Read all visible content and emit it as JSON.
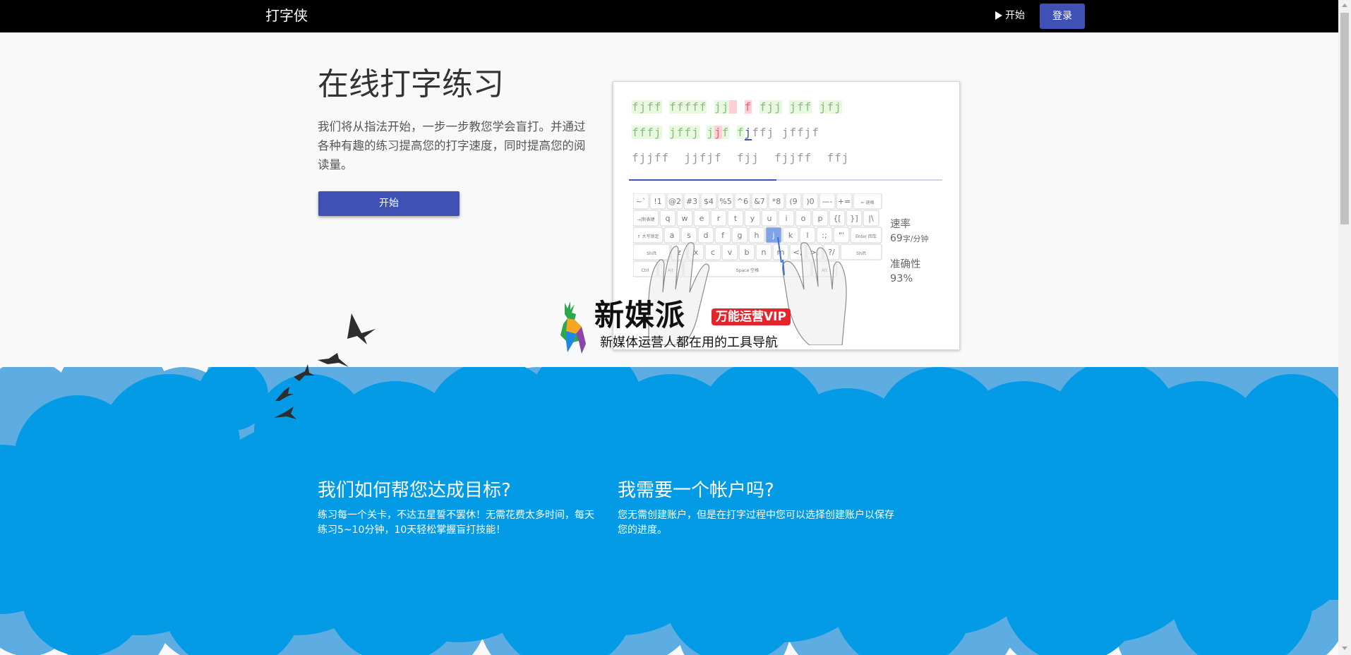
{
  "nav": {
    "brand": "打字侠",
    "start_label": "开始",
    "login_label": "登录"
  },
  "hero": {
    "title": "在线打字练习",
    "description": "我们将从指法开始，一步一步教您学会盲打。并通过各种有趣的练习提高您的打字速度，同时提高您的阅读量。",
    "start_button": "开始"
  },
  "demo": {
    "lines": [
      {
        "segments": [
          {
            "t": "fjff",
            "s": "ok"
          },
          {
            "t": " ",
            "s": "sp"
          },
          {
            "t": "fffff",
            "s": "ok"
          },
          {
            "t": " ",
            "s": "sp"
          },
          {
            "t": "jj",
            "s": "ok"
          },
          {
            "t": " ",
            "s": "err"
          },
          {
            "t": " ",
            "s": "sp"
          },
          {
            "t": "f",
            "s": "err"
          },
          {
            "t": " ",
            "s": "sp"
          },
          {
            "t": "fjj",
            "s": "ok"
          },
          {
            "t": " ",
            "s": "sp"
          },
          {
            "t": "jff",
            "s": "ok"
          },
          {
            "t": " ",
            "s": "sp"
          },
          {
            "t": "jfj",
            "s": "ok"
          }
        ]
      },
      {
        "segments": [
          {
            "t": "fffj",
            "s": "ok"
          },
          {
            "t": " ",
            "s": "sp"
          },
          {
            "t": "jffj",
            "s": "ok"
          },
          {
            "t": " ",
            "s": "sp"
          },
          {
            "t": "j",
            "s": "ok"
          },
          {
            "t": "j",
            "s": "err"
          },
          {
            "t": "f",
            "s": "ok"
          },
          {
            "t": " ",
            "s": "sp"
          },
          {
            "t": "f",
            "s": "ok"
          },
          {
            "t": "j",
            "s": "cur"
          },
          {
            "t": "ffj",
            "s": "rest"
          },
          {
            "t": " ",
            "s": "sp"
          },
          {
            "t": "jffjf",
            "s": "rest"
          }
        ]
      },
      {
        "segments": [
          {
            "t": "fjjff  jjfjf  fjj  fjjff  ffj",
            "s": "rest"
          }
        ]
      }
    ],
    "progress": 0.47,
    "keyboard": {
      "row0": [
        "~`",
        "!1",
        "@2",
        "#3",
        "$4",
        "%5",
        "^6",
        "&7",
        "*8",
        "(9",
        ")0",
        "—-",
        "+="
      ],
      "row0_end": "⇐ 退格",
      "row1_start": "→|制表键",
      "row1": [
        "q",
        "w",
        "e",
        "r",
        "t",
        "y",
        "u",
        "i",
        "o",
        "p",
        "{[",
        "}]",
        "|\\"
      ],
      "row2_start": "⇑ 大写锁定",
      "row2": [
        "a",
        "s",
        "d",
        "f",
        "g",
        "h",
        "j",
        "k",
        "l",
        ":;",
        "\"'"
      ],
      "row2_end": "Enter 回车",
      "row3_start": "Shift",
      "row3": [
        "z",
        "x",
        "c",
        "v",
        "b",
        "n",
        "m",
        "<,",
        ">.",
        "?/"
      ],
      "row3_end": "Shift",
      "row4": [
        "Ctrl",
        "Alt",
        "Space 空格",
        "Alt"
      ],
      "active_key": "j"
    },
    "stats": {
      "speed_label": "速率",
      "speed_value": "69",
      "speed_unit": "字/分钟",
      "accuracy_label": "准确性",
      "accuracy_value": "93%"
    }
  },
  "watermark": {
    "title": "新媒派",
    "badge": "万能运营VIP",
    "subtitle": "新媒体运营人都在用的工具导航"
  },
  "info": [
    {
      "heading": "我们如何帮您达成目标?",
      "text": "练习每一个关卡，不达五星誓不罢休！无需花费太多时间，每天练习5~10分钟，10天轻松掌握盲打技能！"
    },
    {
      "heading": "我需要一个帐户吗?",
      "text": "您无需创建账户，但是在打字过程中您可以选择创建账户以保存您的进度。"
    }
  ],
  "colors": {
    "primary": "#3f51b5",
    "cloud_dark": "#039be5",
    "cloud_light": "#5dade2",
    "correct_bg": "#e7fadf",
    "error_bg": "#ffcfd6"
  }
}
